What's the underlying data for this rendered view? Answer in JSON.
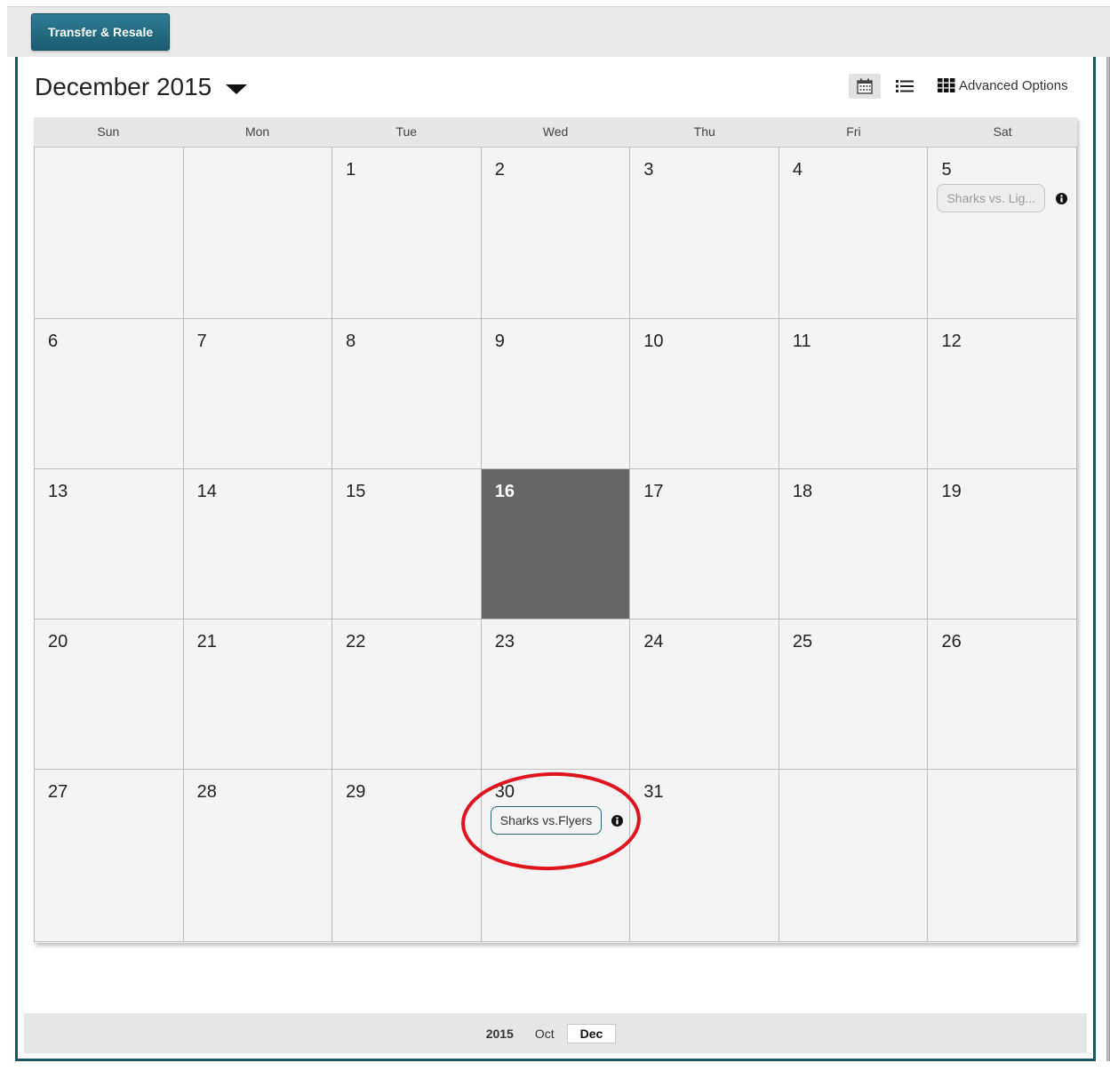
{
  "toolbar": {
    "transfer_button_label": "Transfer & Resale"
  },
  "header": {
    "month_title": "December 2015",
    "views": [
      {
        "name": "calendar-view",
        "icon": "calendar-icon",
        "active": true
      },
      {
        "name": "list-view",
        "icon": "list-icon",
        "active": false
      }
    ],
    "advanced_options_label": "Advanced Options"
  },
  "calendar": {
    "days_of_week": [
      "Sun",
      "Mon",
      "Tue",
      "Wed",
      "Thu",
      "Fri",
      "Sat"
    ],
    "today": "16",
    "weeks": [
      [
        "",
        "",
        "1",
        "2",
        "3",
        "4",
        "5"
      ],
      [
        "6",
        "7",
        "8",
        "9",
        "10",
        "11",
        "12"
      ],
      [
        "13",
        "14",
        "15",
        "16",
        "17",
        "18",
        "19"
      ],
      [
        "20",
        "21",
        "22",
        "23",
        "24",
        "25",
        "26"
      ],
      [
        "27",
        "28",
        "29",
        "30",
        "31",
        "",
        ""
      ]
    ],
    "events": [
      {
        "day": "5",
        "label": "Sharks vs. Lig...",
        "active": false
      },
      {
        "day": "30",
        "label": "Sharks vs.Flyers",
        "active": true
      }
    ]
  },
  "footer": {
    "year": "2015",
    "months": [
      {
        "label": "Oct",
        "active": false
      },
      {
        "label": "Dec",
        "active": true
      }
    ]
  },
  "colors": {
    "brand": "#1b5568",
    "button": "#256c84",
    "today": "#666666",
    "annotation": "#e0141e"
  }
}
